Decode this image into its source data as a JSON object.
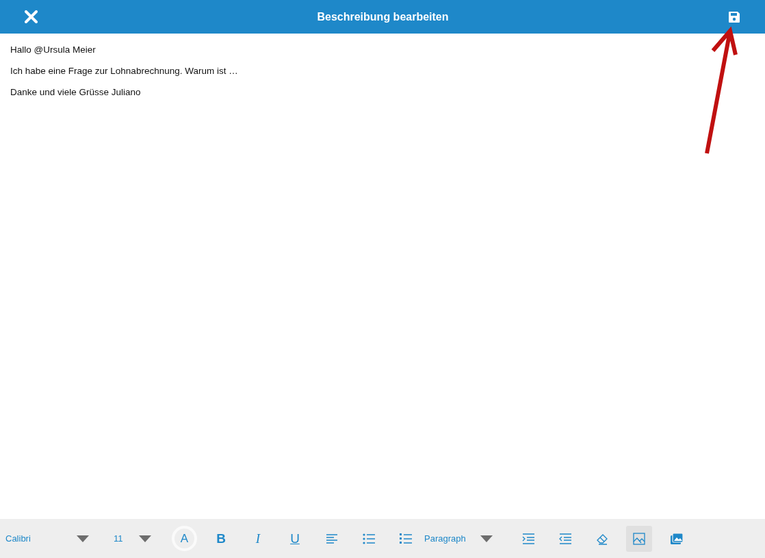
{
  "header": {
    "title": "Beschreibung bearbeiten"
  },
  "editor": {
    "paragraphs": [
      "Hallo @Ursula Meier",
      "Ich habe eine Frage zur Lohnabrechnung. Warum ist …",
      "Danke und viele Grüsse Juliano"
    ]
  },
  "toolbar": {
    "items": [
      {
        "kind": "select",
        "label": "Calibri",
        "selected": false
      },
      {
        "kind": "select",
        "label": "11",
        "selected": false
      },
      {
        "kind": "color",
        "label": "A",
        "selected": false
      },
      {
        "kind": "bold",
        "label": "B",
        "selected": false
      },
      {
        "kind": "italic",
        "label": "I",
        "selected": false
      },
      {
        "kind": "underline",
        "label": "U",
        "selected": false
      },
      {
        "kind": "align-left",
        "selected": false
      },
      {
        "kind": "bullet-list",
        "selected": false
      },
      {
        "kind": "numbered-list",
        "selected": false
      },
      {
        "kind": "select",
        "label": "Paragraph",
        "selected": false
      },
      {
        "kind": "indent",
        "selected": false
      },
      {
        "kind": "outdent",
        "selected": false
      },
      {
        "kind": "eraser",
        "selected": false
      },
      {
        "kind": "image",
        "selected": true
      },
      {
        "kind": "gallery",
        "selected": false
      }
    ]
  }
}
